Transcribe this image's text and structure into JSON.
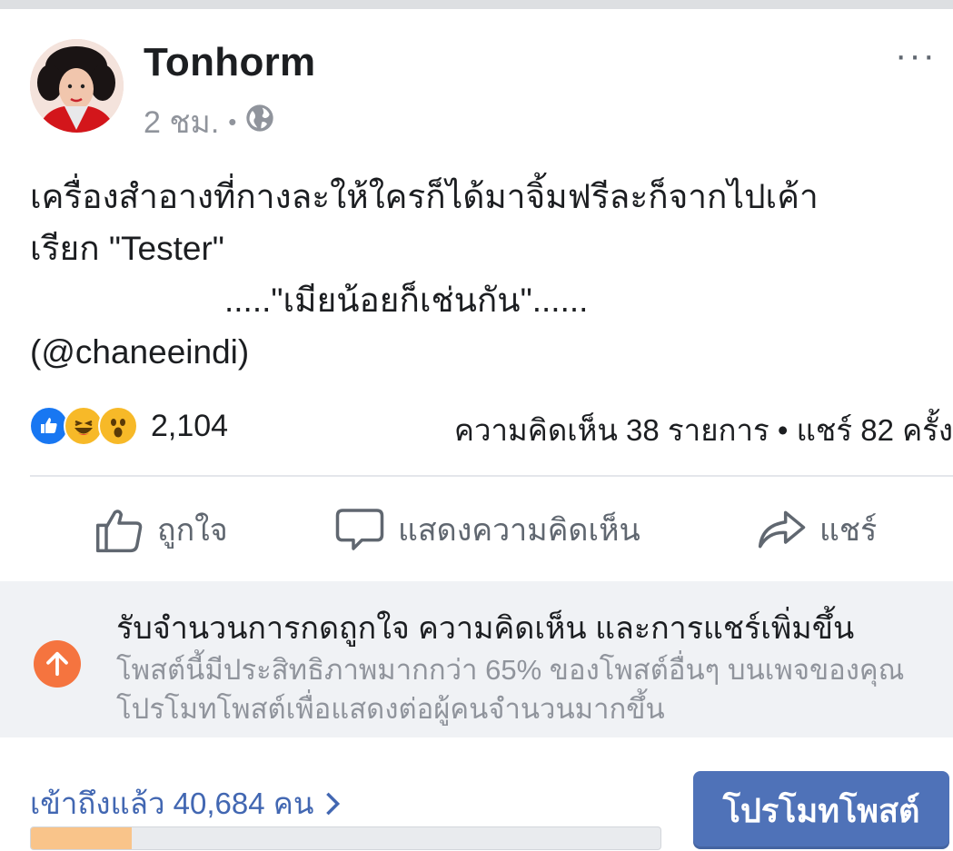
{
  "post": {
    "author": "Tonhorm",
    "time": "2 ชม.",
    "meta_separator": "•",
    "privacy_icon": "globe-icon",
    "menu_label": "···",
    "text_lines": [
      "เครื่องสำอางที่กางละให้ใครก็ได้มาจิ้มฟรีละก็จากไปเค้า",
      "เรียก \"Tester\"",
      ".....\"เมียน้อยก็เช่นกัน\"......",
      "(@chaneeindi)"
    ]
  },
  "reactions": {
    "icons": [
      "like-reaction-icon",
      "haha-reaction-icon",
      "wow-reaction-icon"
    ],
    "count": "2,104",
    "stats": "ความคิดเห็น 38 รายการ • แชร์ 82 ครั้ง"
  },
  "actions": {
    "like": "ถูกใจ",
    "comment": "แสดงความคิดเห็น",
    "share": "แชร์"
  },
  "promo": {
    "title": "รับจำนวนการกดถูกใจ ความคิดเห็น และการแชร์เพิ่มขึ้น",
    "desc_line1": "โพสต์นี้มีประสิทธิภาพมากกว่า 65% ของโพสต์อื่นๆ บนเพจของคุณ",
    "desc_line2": "โปรโมทโพสต์เพื่อแสดงต่อผู้คนจำนวนมากขึ้น",
    "accent": "#f5743f"
  },
  "reach": {
    "label": "เข้าถึงแล้ว 40,684 คน",
    "progress_fraction": 0.16,
    "promote_button": "โปรโมทโพสต์"
  },
  "colors": {
    "link": "#4267b2",
    "button": "#4f72b8",
    "progress": "#f9c48a"
  }
}
